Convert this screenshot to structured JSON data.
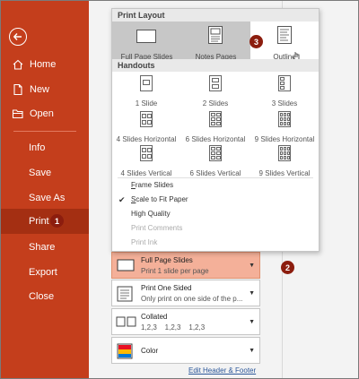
{
  "nav": {
    "items": [
      {
        "label": "Home",
        "icon": "home-icon"
      },
      {
        "label": "New",
        "icon": "new-document-icon"
      },
      {
        "label": "Open",
        "icon": "folder-icon"
      },
      {
        "label": "Info"
      },
      {
        "label": "Save"
      },
      {
        "label": "Save As"
      },
      {
        "label": "Print",
        "active": true
      },
      {
        "label": "Share"
      },
      {
        "label": "Export"
      },
      {
        "label": "Close"
      }
    ],
    "active_color": "#a42f12",
    "bg_color": "#c43e1c"
  },
  "badges": {
    "b1": "1",
    "b2": "2",
    "b3": "3"
  },
  "popup": {
    "print_layout_header": "Print Layout",
    "layouts": [
      {
        "label": "Full Page Slides",
        "selected": true
      },
      {
        "label": "Notes Pages",
        "selected": true
      },
      {
        "label": "Outline",
        "selected": false
      }
    ],
    "handouts_header": "Handouts",
    "handouts": [
      {
        "label": "1 Slide"
      },
      {
        "label": "2 Slides"
      },
      {
        "label": "3 Slides"
      },
      {
        "label": "4 Slides Horizontal"
      },
      {
        "label": "6 Slides Horizontal"
      },
      {
        "label": "9 Slides Horizontal"
      },
      {
        "label": "4 Slides Vertical"
      },
      {
        "label": "6 Slides Vertical"
      },
      {
        "label": "9 Slides Vertical"
      }
    ],
    "options": {
      "frame_slides": {
        "pre": "",
        "ul": "F",
        "post": "rame Slides"
      },
      "scale_to_fit": {
        "pre": "",
        "ul": "S",
        "post": "cale to Fit Paper"
      },
      "high_quality": "High Quality",
      "print_comments": "Print Comments",
      "print_ink": "Print Ink"
    }
  },
  "settings": {
    "slides": {
      "title": "Full Page Slides",
      "subtitle": "Print 1 slide per page"
    },
    "sides": {
      "title": "Print One Sided",
      "subtitle": "Only print on one side of the p..."
    },
    "collate": {
      "title": "Collated",
      "subtitle": "1,2,3    1,2,3    1,2,3"
    },
    "color": {
      "title": "Color"
    }
  },
  "footer_link": "Edit Header & Footer",
  "colors": {
    "highlight": "#f4b099",
    "link": "#2b579a"
  }
}
